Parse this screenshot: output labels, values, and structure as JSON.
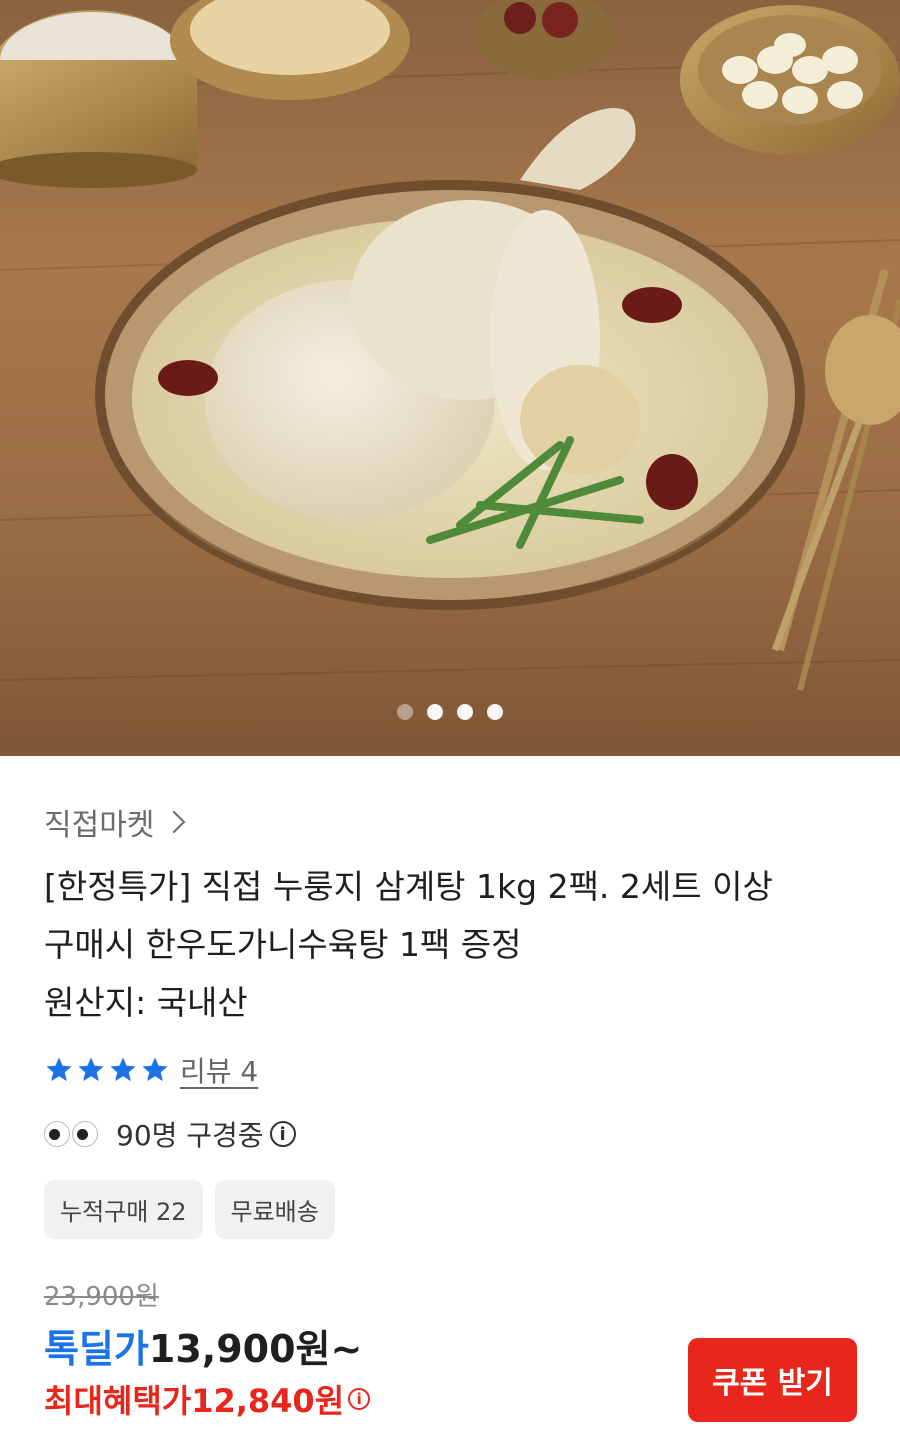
{
  "hero": {
    "carousel": {
      "total": 4,
      "active": 0
    }
  },
  "seller": {
    "name": "직접마켓"
  },
  "product": {
    "title_lines": [
      "[한정특가] 직접 누룽지 삼계탕 1kg 2팩. 2세트 이상",
      "구매시 한우도가니수육탕 1팩 증정"
    ],
    "origin": "원산지: 국내산"
  },
  "rating": {
    "stars": 4,
    "review_label": "리뷰 4"
  },
  "viewers": {
    "text": "90명 구경중"
  },
  "tags": [
    "누적구매 22",
    "무료배송"
  ],
  "price": {
    "original": "23,900원",
    "deal_label": "톡딜가",
    "deal_price": "13,900원~",
    "max_benefit_label": "최대혜택가",
    "max_benefit_price": "12,840원"
  },
  "coupon_button": {
    "label": "쿠폰 받기"
  },
  "colors": {
    "accent_blue": "#1a73e8",
    "accent_red": "#e8261b",
    "star": "#1a73e8"
  }
}
